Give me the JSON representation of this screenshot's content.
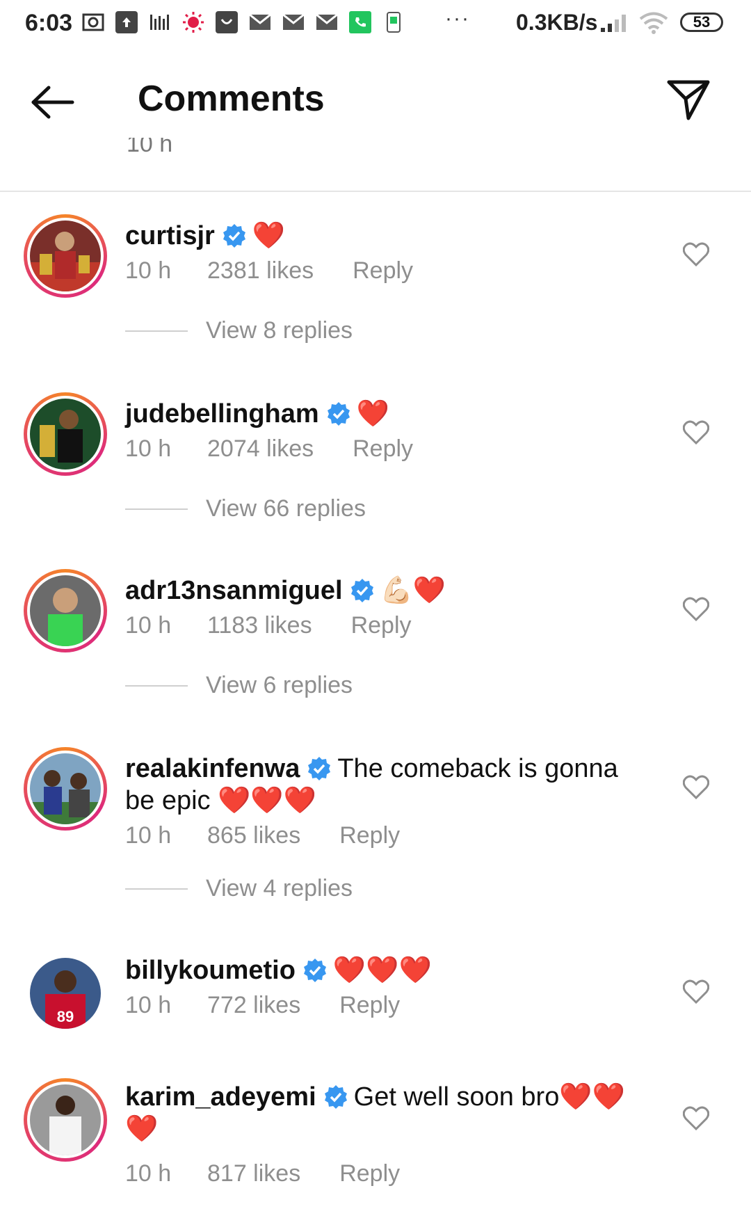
{
  "status_bar": {
    "time": "6:03",
    "more": "···",
    "speed": "0.3KB/s",
    "battery": "53"
  },
  "header": {
    "title": "Comments",
    "cut_text": "10 h"
  },
  "comments": [
    {
      "username": "curtisjr",
      "text": "",
      "emoji": "❤️",
      "time": "10 h",
      "likes": "2381 likes",
      "reply": "Reply",
      "view_replies": "View 8 replies",
      "ring": true
    },
    {
      "username": "judebellingham",
      "text": "",
      "emoji": "❤️",
      "time": "10 h",
      "likes": "2074 likes",
      "reply": "Reply",
      "view_replies": "View 66 replies",
      "ring": true
    },
    {
      "username": "adr13nsanmiguel",
      "text": "",
      "emoji": "💪🏻❤️",
      "time": "10 h",
      "likes": "1183 likes",
      "reply": "Reply",
      "view_replies": "View 6 replies",
      "ring": true
    },
    {
      "username": "realakinfenwa",
      "text": "The comeback is gonna be epic",
      "emoji": "❤️❤️❤️",
      "time": "10 h",
      "likes": "865 likes",
      "reply": "Reply",
      "view_replies": "View 4 replies",
      "ring": true
    },
    {
      "username": "billykoumetio",
      "text": "",
      "emoji": "❤️❤️❤️",
      "time": "10 h",
      "likes": "772 likes",
      "reply": "Reply",
      "view_replies": "",
      "ring": false
    },
    {
      "username": "karim_adeyemi",
      "text": "Get well soon bro",
      "emoji": "❤️❤️❤️",
      "time": "10 h",
      "likes": "817 likes",
      "reply": "Reply",
      "view_replies": "",
      "ring": true
    }
  ],
  "icons": {
    "back": "arrow-left",
    "send": "paper-plane",
    "verified": "blue-check-badge",
    "like": "heart-outline"
  },
  "colors": {
    "verified": "#3897f0",
    "heart": "#e0192f",
    "meta": "#8e8e8e",
    "ring_start": "#f58529",
    "ring_end": "#dd2a7b"
  }
}
